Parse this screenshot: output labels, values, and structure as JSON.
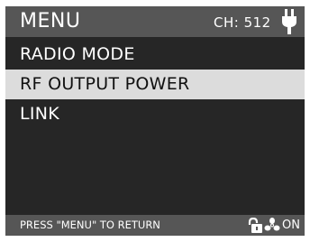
{
  "header": {
    "title": "MENU",
    "channel": "CH: 512",
    "power_icon": "plug-icon"
  },
  "menu": {
    "items": [
      {
        "label": "RADIO MODE",
        "selected": false
      },
      {
        "label": "RF OUTPUT POWER",
        "selected": true
      },
      {
        "label": "LINK",
        "selected": false
      }
    ]
  },
  "footer": {
    "hint": "PRESS \"MENU\" TO RETURN",
    "lock_icon": "unlock-icon",
    "fan_icon": "fan-icon",
    "status": "ON"
  },
  "colors": {
    "background": "#262626",
    "bar": "#565656",
    "selected_row": "#dcdcdc",
    "text": "#ffffff"
  }
}
